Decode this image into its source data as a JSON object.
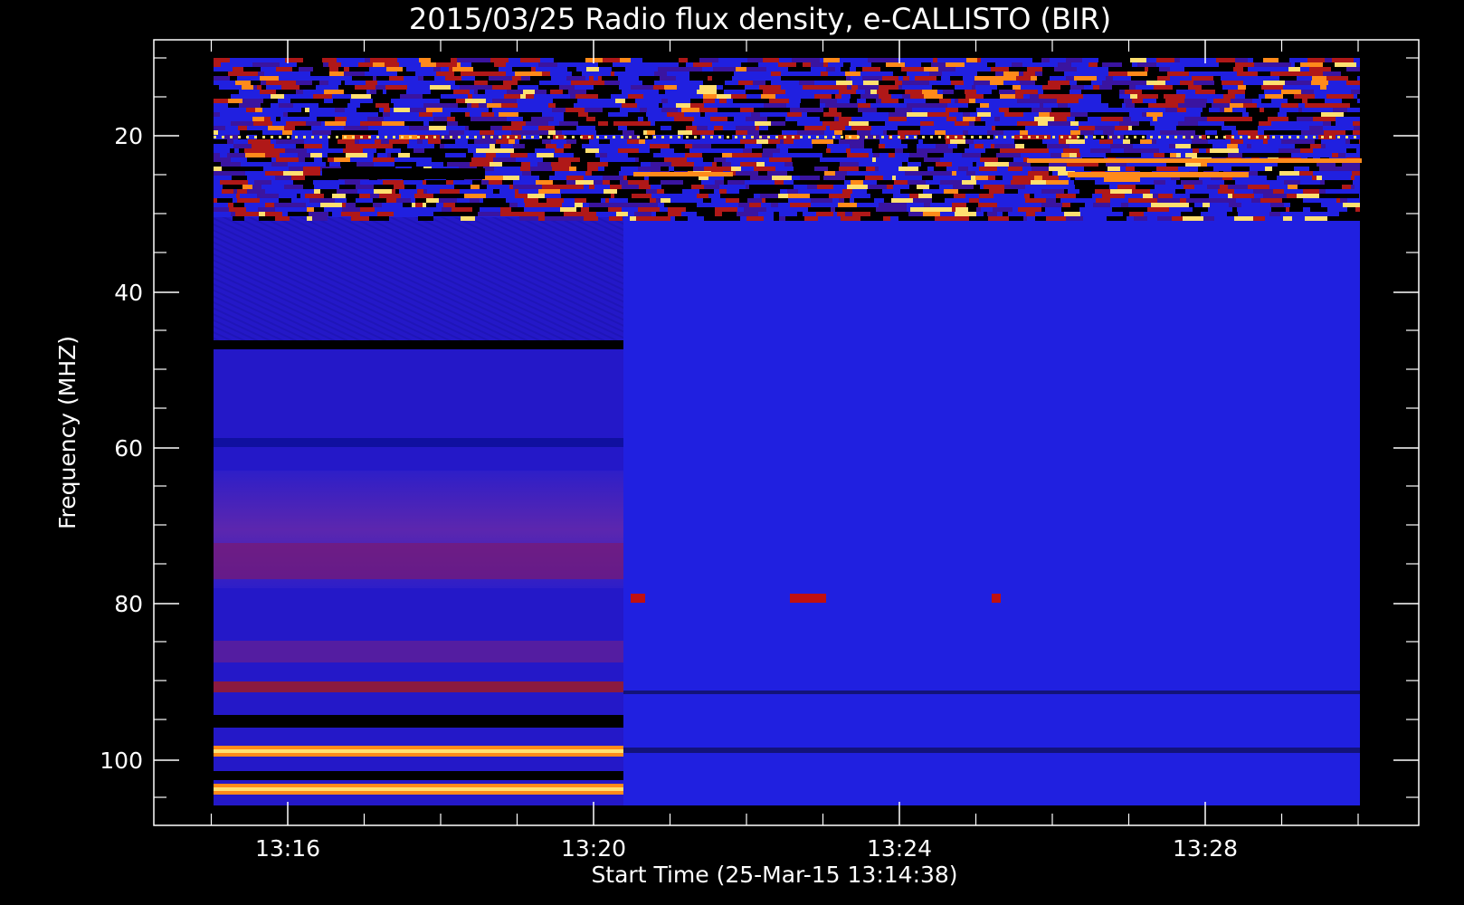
{
  "chart_data": {
    "type": "heatmap",
    "title": "2015/03/25  Radio flux density, e-CALLISTO (BIR)",
    "xlabel": "Start Time (25-Mar-15 13:14:38)",
    "ylabel": "Frequency (MHZ)",
    "x_ticks": [
      "13:16",
      "13:20",
      "13:24",
      "13:28"
    ],
    "y_ticks": [
      "20",
      "40",
      "60",
      "80",
      "100"
    ],
    "colors": {
      "background": "#000000",
      "base": "#2020e0",
      "low": "#000000",
      "mid": "#b01818",
      "high": "#ff8a1a",
      "peak": "#ffe070"
    }
  }
}
